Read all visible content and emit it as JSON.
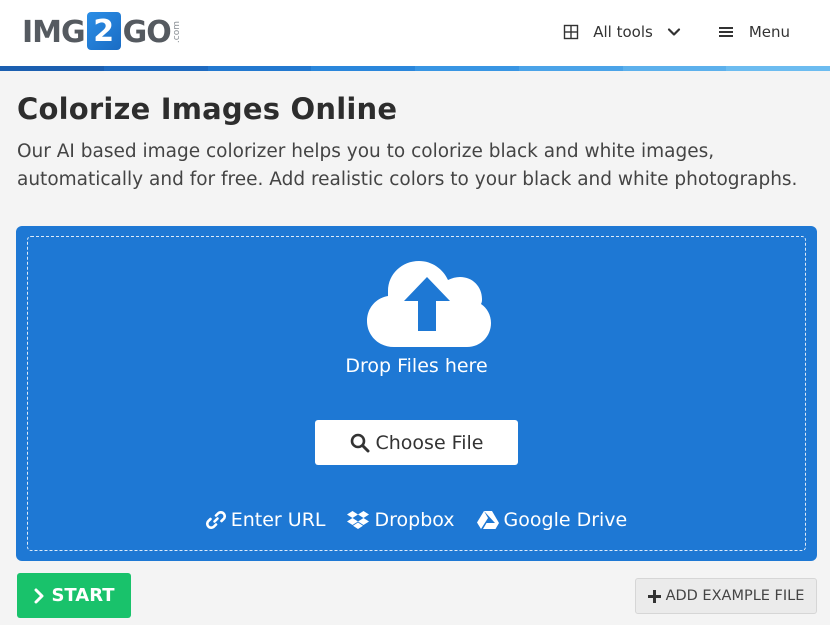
{
  "logo": {
    "part1": "IMG",
    "part2": "2",
    "part3": "GO",
    "suffix": ".com"
  },
  "nav": {
    "all_tools_label": "All tools",
    "menu_label": "Menu"
  },
  "stripe_colors": [
    "#1b5fb0",
    "#1e6ac0",
    "#2278cf",
    "#2a86db",
    "#3895e3",
    "#4aa3e8",
    "#5cb0ec",
    "#6cbcf0"
  ],
  "page": {
    "title": "Colorize Images Online",
    "description": "Our AI based image colorizer helps you to colorize black and white images, automatically and for free. Add realistic colors to your black and white photographs."
  },
  "upload": {
    "drop_label": "Drop Files here",
    "choose_label": "Choose File",
    "sources": {
      "url_label": "Enter URL",
      "dropbox_label": "Dropbox",
      "gdrive_label": "Google Drive"
    }
  },
  "actions": {
    "start_label": "START",
    "example_label": "ADD EXAMPLE FILE"
  },
  "colors": {
    "accent_blue": "#1e78d4",
    "start_green": "#19c26b"
  },
  "icons": {
    "grid": "grid-icon",
    "chevron": "chevron-down-icon",
    "menu": "hamburger-icon",
    "cloud": "cloud-upload-icon",
    "search": "search-icon",
    "link": "link-icon",
    "dropbox": "dropbox-icon",
    "gdrive": "google-drive-icon",
    "start": "chevron-right-icon",
    "plus": "plus-icon"
  }
}
